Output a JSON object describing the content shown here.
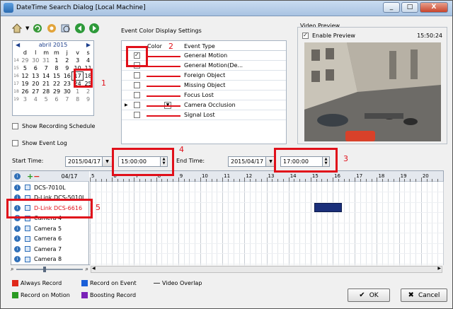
{
  "window": {
    "title": "DateTime Search Dialog [Local Machine]",
    "controls": [
      "_",
      "□",
      "X"
    ]
  },
  "toolbar": {
    "icons": [
      "home-icon",
      "chevron-down-icon",
      "refresh-icon",
      "search-settings-icon",
      "zoom-icon",
      "prev-icon",
      "next-icon"
    ]
  },
  "calendar": {
    "month": "abril 2015",
    "day_headers": [
      "d",
      "l",
      "m",
      "m",
      "j",
      "v",
      "s"
    ],
    "weeks": [
      {
        "wk": "14",
        "days": [
          "29",
          "30",
          "31",
          "1",
          "2",
          "3",
          "4"
        ]
      },
      {
        "wk": "15",
        "days": [
          "5",
          "6",
          "7",
          "8",
          "9",
          "10",
          "11"
        ]
      },
      {
        "wk": "16",
        "days": [
          "12",
          "13",
          "14",
          "15",
          "16",
          "17",
          "18"
        ]
      },
      {
        "wk": "17",
        "days": [
          "19",
          "20",
          "21",
          "22",
          "23",
          "24",
          "25"
        ]
      },
      {
        "wk": "18",
        "days": [
          "26",
          "27",
          "28",
          "29",
          "30",
          "1",
          "2"
        ]
      },
      {
        "wk": "19",
        "days": [
          "3",
          "4",
          "5",
          "6",
          "7",
          "8",
          "9"
        ]
      }
    ],
    "selected_day": "17"
  },
  "options": {
    "show_recording_schedule": "Show Recording Schedule",
    "show_event_log": "Show Event Log"
  },
  "event_settings": {
    "title": "Event Color Display Settings",
    "col_color": "Color",
    "col_event_type": "Event Type",
    "events": [
      {
        "label": "General Motion",
        "checked": true
      },
      {
        "label": "General Motion(De...",
        "checked": false
      },
      {
        "label": "Foreign Object",
        "checked": false
      },
      {
        "label": "Missing Object",
        "checked": false
      },
      {
        "label": "Focus Lost",
        "checked": false
      },
      {
        "label": "Camera Occlusion",
        "checked": false
      },
      {
        "label": "Signal Lost",
        "checked": false
      }
    ]
  },
  "video_preview": {
    "title": "Video Preview",
    "enable_label": "Enable Preview",
    "time": "15:50:24"
  },
  "time_range": {
    "start_label": "Start Time:",
    "start_date": "2015/04/17",
    "start_time": "15:00:00",
    "end_label": "End Time:",
    "end_date": "2015/04/17",
    "end_time": "17:00:00"
  },
  "timeline": {
    "date": "04/17",
    "hours": [
      "5",
      "6",
      "7",
      "8",
      "9",
      "10",
      "11",
      "12",
      "13",
      "14",
      "15",
      "16",
      "17",
      "18",
      "19",
      "20"
    ],
    "cameras": [
      "DCS-7010L",
      "D-Link DCS-5010L",
      "D-Link DCS-6616",
      "Camera 4",
      "Camera 5",
      "Camera 6",
      "Camera 7",
      "Camera 8"
    ],
    "selected_camera": "D-Link DCS-6616"
  },
  "annotations": [
    "1",
    "2",
    "3",
    "4",
    "5"
  ],
  "legend": [
    {
      "label": "Always Record",
      "color": "#e0281a"
    },
    {
      "label": "Record on Event",
      "color": "#1a5fd8"
    },
    {
      "label": "Record on Motion",
      "color": "#2a9a22"
    },
    {
      "label": "Boosting Record",
      "color": "#7a22b8"
    },
    {
      "label": "Video Overlap",
      "color": "#333333"
    }
  ],
  "buttons": {
    "ok": "OK",
    "cancel": "Cancel"
  }
}
